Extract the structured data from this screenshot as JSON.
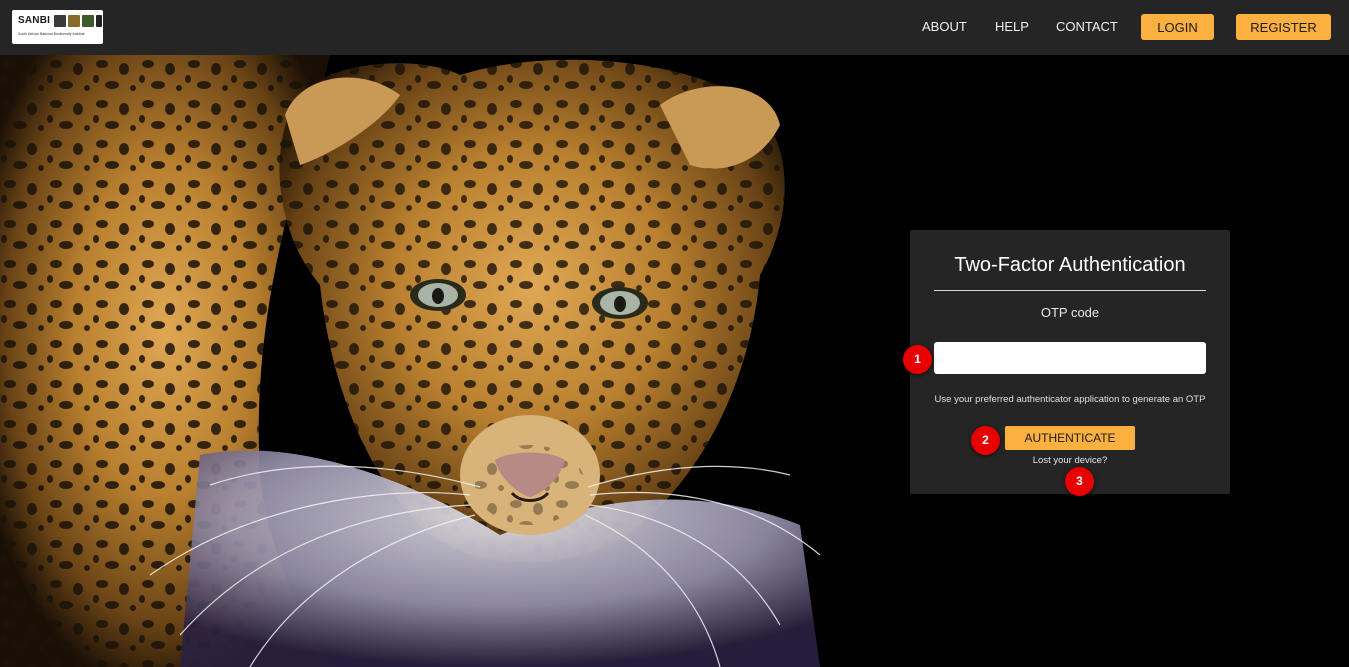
{
  "brand": {
    "logo_text": "SANBI",
    "logo_subtext": "South African National Biodiversity Institute"
  },
  "nav": {
    "about": "ABOUT",
    "help": "HELP",
    "contact": "CONTACT",
    "login": "LOGIN",
    "register": "REGISTER"
  },
  "auth_card": {
    "title": "Two-Factor Authentication",
    "otp_label": "OTP code",
    "otp_value": "",
    "help_text": "Use your preferred authenticator application to generate an OTP",
    "authenticate_label": "AUTHENTICATE",
    "lost_device_label": "Lost your device?"
  },
  "markers": [
    "1",
    "2",
    "3"
  ],
  "colors": {
    "navbar_bg": "#252525",
    "accent": "#fbb040",
    "card_bg": "#252525",
    "marker_red": "#e60000"
  },
  "background_image": "leopard-photo"
}
